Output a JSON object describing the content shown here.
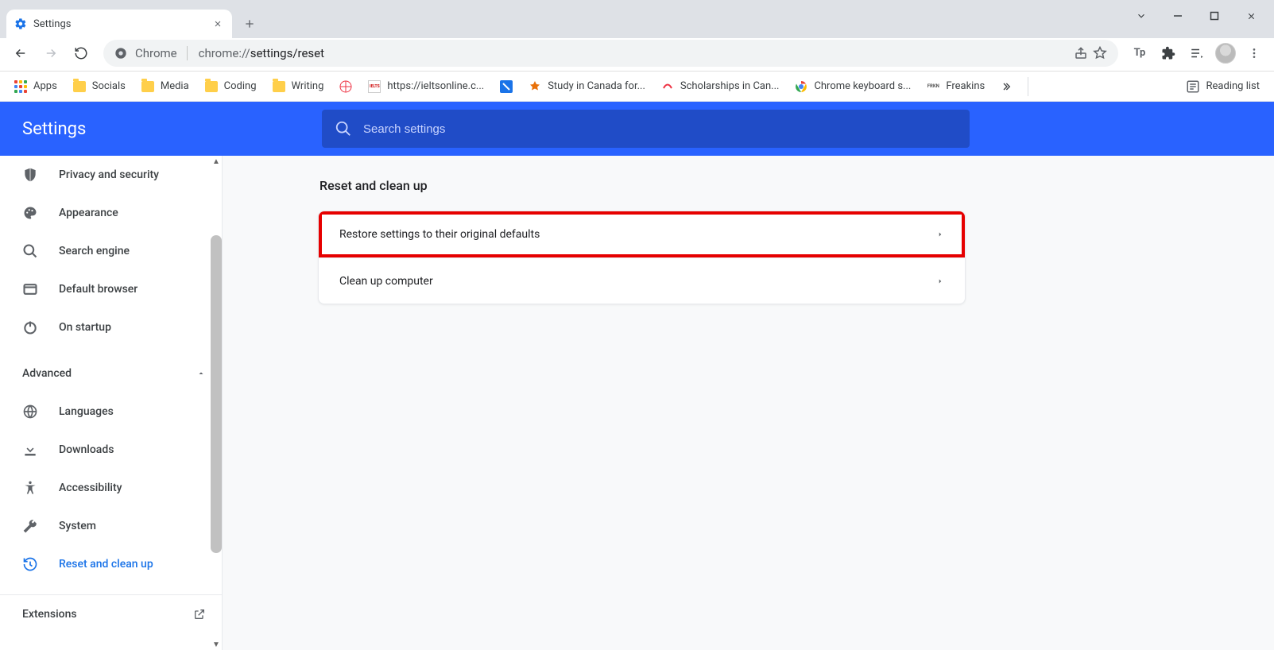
{
  "tab": {
    "title": "Settings"
  },
  "omnibox": {
    "chip_label": "Chrome",
    "url_prefix": "chrome://",
    "url_path": "settings/reset"
  },
  "toolbar_ext_labels": {
    "tp": "Tp"
  },
  "bookmarks": {
    "apps": "Apps",
    "socials": "Socials",
    "media": "Media",
    "coding": "Coding",
    "writing": "Writing",
    "ielts": "https://ieltsonline.c...",
    "study": "Study in Canada for...",
    "scholarships": "Scholarships in Can...",
    "keyboard": "Chrome keyboard s...",
    "freakins": "Freakins",
    "reading_list": "Reading list"
  },
  "settings_header": {
    "title": "Settings",
    "search_placeholder": "Search settings"
  },
  "sidebar": {
    "privacy": "Privacy and security",
    "appearance": "Appearance",
    "search_engine": "Search engine",
    "default_browser": "Default browser",
    "on_startup": "On startup",
    "advanced": "Advanced",
    "languages": "Languages",
    "downloads": "Downloads",
    "accessibility": "Accessibility",
    "system": "System",
    "reset": "Reset and clean up",
    "extensions": "Extensions"
  },
  "main": {
    "heading": "Reset and clean up",
    "row_restore": "Restore settings to their original defaults",
    "row_cleanup": "Clean up computer"
  }
}
